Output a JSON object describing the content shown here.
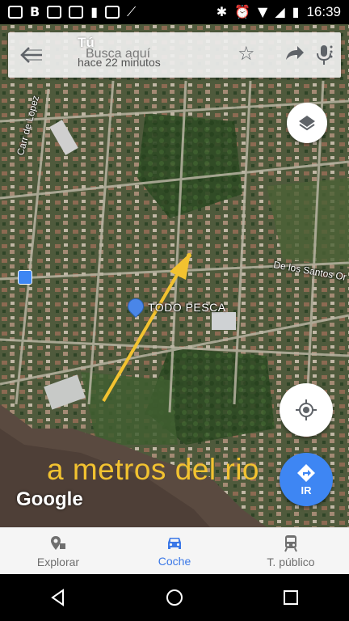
{
  "status_bar": {
    "time": "16:39",
    "left_icons": [
      "mail-icon",
      "b-icon",
      "flipboard-icon",
      "amazon-icon",
      "notification-icon",
      "image-icon",
      "chart-icon"
    ],
    "right_icons": [
      "bluetooth-icon",
      "alarm-icon",
      "wifi-icon",
      "signal-icon",
      "battery-icon"
    ]
  },
  "search": {
    "title": "Tú",
    "placeholder": "Busca aquí",
    "subtitle": "hace 22 minutos"
  },
  "map": {
    "place_name": "TODO PESCA",
    "streets": [
      "Carr de Lopez",
      "De los Santos Or"
    ],
    "annotation": "a metros del rio",
    "annotation_color": "#f2c230",
    "brand": "Google"
  },
  "go_button": {
    "label": "IR",
    "color": "#3e86f3"
  },
  "bottom_nav": {
    "tabs": [
      {
        "label": "Explorar",
        "icon": "explore-pin-icon",
        "active": false
      },
      {
        "label": "Coche",
        "icon": "car-icon",
        "active": true
      },
      {
        "label": "T. público",
        "icon": "transit-icon",
        "active": false
      }
    ],
    "active_color": "#3b78e7"
  },
  "system_nav": [
    "back-icon",
    "home-icon",
    "recents-icon"
  ]
}
